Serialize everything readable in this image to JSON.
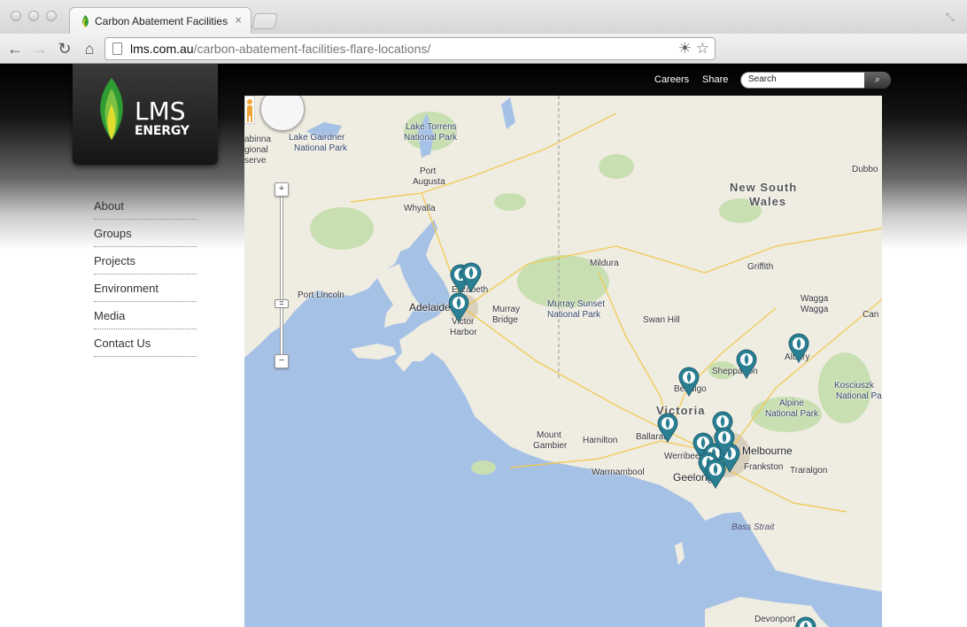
{
  "browser": {
    "tab_title": "Carbon Abatement Facilities",
    "tab_close": "×",
    "url_host": "lms.com.au",
    "url_path": "/carbon-abatement-facilities-flare-locations/"
  },
  "header": {
    "logo_primary": "LMS",
    "logo_secondary": "ENERGY",
    "nav": [
      "Careers",
      "Share"
    ],
    "search_placeholder": "Search"
  },
  "sidebar": {
    "items": [
      {
        "label": "About"
      },
      {
        "label": "Groups"
      },
      {
        "label": "Projects"
      },
      {
        "label": "Environment"
      },
      {
        "label": "Media"
      },
      {
        "label": "Contact Us"
      }
    ]
  },
  "map": {
    "zoom_in": "+",
    "zoom_out": "−",
    "states": [
      "New South",
      "Wales",
      "Victoria"
    ],
    "places": [
      "Lake Torrens",
      "National Park",
      "Lake Gairdner",
      "National Park",
      "abinna",
      "gional",
      "serve",
      "Port",
      "Augusta",
      "Whyalla",
      "Dubbo",
      "Mildura",
      "Griffith",
      "Port Lincoln",
      "Adelaide",
      "Elizabeth",
      "Murray",
      "Bridge",
      "Victor",
      "Harbor",
      "Murray Sunset",
      "National Park",
      "Swan Hill",
      "Wagga",
      "Wagga",
      "Can",
      "Albury",
      "Shepparton",
      "Bendigo",
      "Kosciuszk",
      "National Pa",
      "Alpine",
      "National Park",
      "Ballarat",
      "Melbourne",
      "Mount",
      "Gambier",
      "Hamilton",
      "Werribee",
      "Frankston",
      "Geelong",
      "Warrnambool",
      "Traralgon",
      "Bass Strait",
      "Devonport"
    ],
    "colors": {
      "water": "#a6c1e6",
      "land": "#efece2",
      "park": "#c8dfb1",
      "marker": "#2a7f93"
    }
  }
}
